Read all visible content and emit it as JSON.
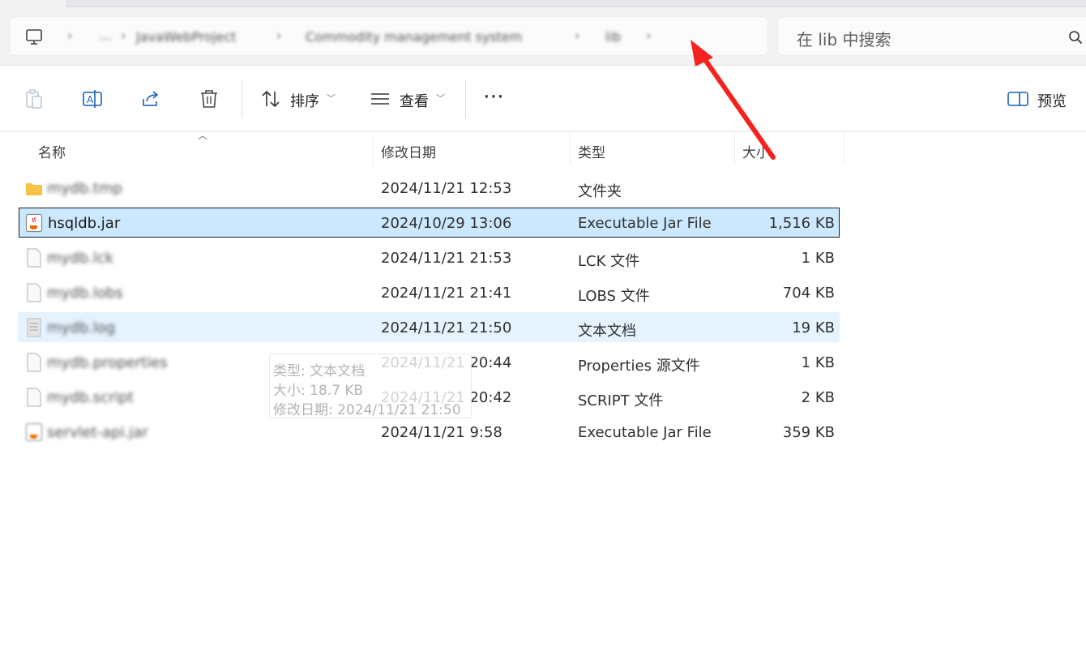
{
  "breadcrumb": {
    "items": [
      "JavaWebProject",
      "Commodity management system",
      "lib"
    ],
    "overflow": "…"
  },
  "search": {
    "text": "在 lib 中搜索"
  },
  "toolbar": {
    "sort_label": "排序",
    "view_label": "查看",
    "more_label": "⋯",
    "preview_label": "预览"
  },
  "columns": {
    "name": "名称",
    "modified": "修改日期",
    "type": "类型",
    "size": "大小"
  },
  "files": [
    {
      "name": "mydb.tmp",
      "modified": "2024/11/21 12:53",
      "type": "文件夹",
      "size": ""
    },
    {
      "name": "hsqldb.jar",
      "modified": "2024/10/29 13:06",
      "type": "Executable Jar File",
      "size": "1,516 KB"
    },
    {
      "name": "mydb.lck",
      "modified": "2024/11/21 21:53",
      "type": "LCK 文件",
      "size": "1 KB"
    },
    {
      "name": "mydb.lobs",
      "modified": "2024/11/21 21:41",
      "type": "LOBS 文件",
      "size": "704 KB"
    },
    {
      "name": "mydb.log",
      "modified": "2024/11/21 21:50",
      "type": "文本文档",
      "size": "19 KB"
    },
    {
      "name": "mydb.properties",
      "modified": "2024/11/21 20:44",
      "type": "Properties 源文件",
      "size": "1 KB"
    },
    {
      "name": "mydb.script",
      "modified": "2024/11/21 20:42",
      "type": "SCRIPT 文件",
      "size": "2 KB"
    },
    {
      "name": "servlet-api.jar",
      "modified": "2024/11/21 9:58",
      "type": "Executable Jar File",
      "size": "359 KB"
    }
  ],
  "tooltip": {
    "type_line": "类型: 文本文档",
    "size_line": "大小: 18.7 KB",
    "date_line": "修改日期: 2024/11/21 21:50"
  },
  "colors": {
    "selection": "#cce8ff",
    "hover": "#e5f3ff",
    "arrow": "#f4231f",
    "folder": "#f6c344"
  }
}
